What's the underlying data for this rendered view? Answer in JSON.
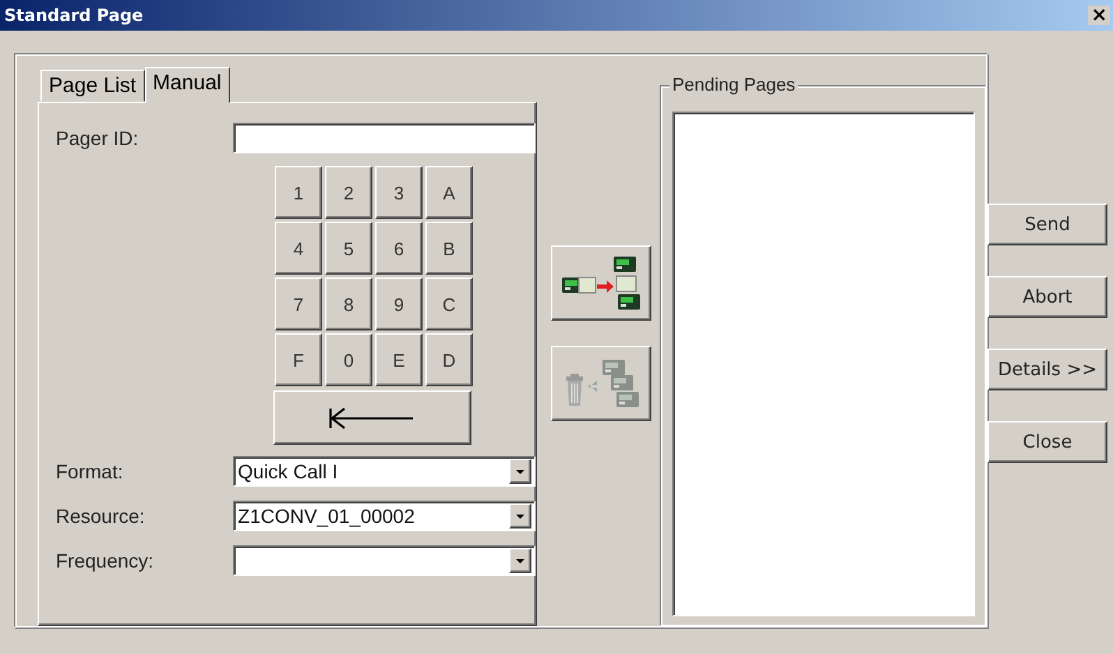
{
  "window": {
    "title": "Standard Page",
    "close": "×"
  },
  "tabs": [
    {
      "label": "Page List",
      "selected": false
    },
    {
      "label": "Manual",
      "selected": true
    }
  ],
  "pager_id": {
    "label": "Pager ID:"
  },
  "keypad": [
    "1",
    "2",
    "3",
    "A",
    "4",
    "5",
    "6",
    "B",
    "7",
    "8",
    "9",
    "C",
    "F",
    "0",
    "E",
    "D"
  ],
  "dropdowns": [
    {
      "label": "Format:",
      "value": "Quick Call I"
    },
    {
      "label": "Resource:",
      "value": "Z1CONV_01_00002"
    },
    {
      "label": "Frequency:"
    }
  ],
  "transfer_buttons": [
    {
      "kind": "add",
      "disabled": false
    },
    {
      "kind": "remove",
      "disabled": true
    }
  ],
  "pending_pages": {
    "title": "Pending Pages"
  },
  "buttons": [
    "Send",
    "Abort",
    "Details >>",
    "Close"
  ]
}
